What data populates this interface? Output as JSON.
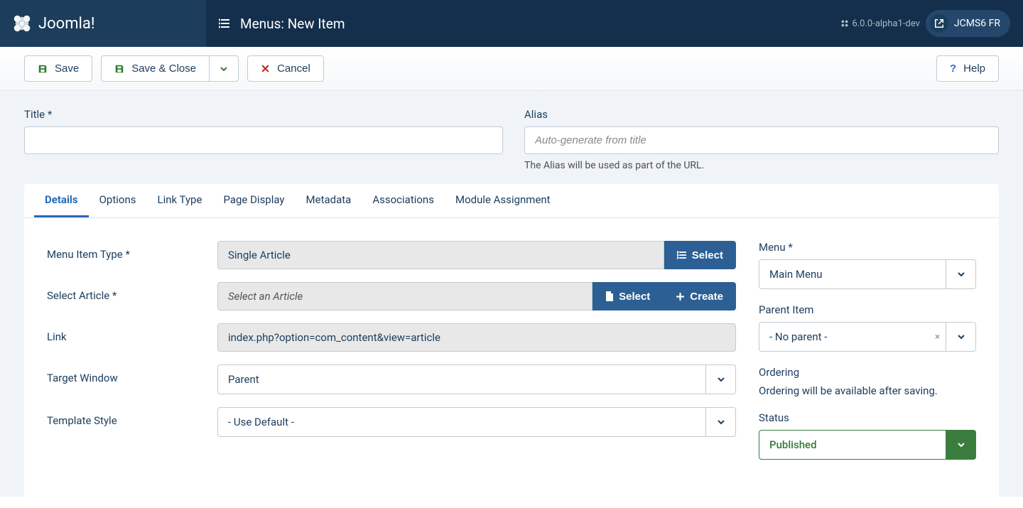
{
  "app": {
    "brand": "Joomla!",
    "version": "6.0.0-alpha1-dev",
    "site_name": "JCMS6 FR"
  },
  "page": {
    "title": "Menus: New Item"
  },
  "toolbar": {
    "save": "Save",
    "save_close": "Save & Close",
    "cancel": "Cancel",
    "help": "Help"
  },
  "fields": {
    "title_label": "Title *",
    "alias_label": "Alias",
    "alias_placeholder": "Auto-generate from title",
    "alias_help": "The Alias will be used as part of the URL."
  },
  "tabs": [
    "Details",
    "Options",
    "Link Type",
    "Page Display",
    "Metadata",
    "Associations",
    "Module Assignment"
  ],
  "details": {
    "menu_item_type_label": "Menu Item Type *",
    "menu_item_type_value": "Single Article",
    "select_btn": "Select",
    "select_article_label": "Select Article *",
    "select_article_placeholder": "Select an Article",
    "article_select_btn": "Select",
    "article_create_btn": "Create",
    "link_label": "Link",
    "link_value": "index.php?option=com_content&view=article",
    "target_window_label": "Target Window",
    "target_window_value": "Parent",
    "template_style_label": "Template Style",
    "template_style_value": "- Use Default -"
  },
  "side": {
    "menu_label": "Menu *",
    "menu_value": "Main Menu",
    "parent_label": "Parent Item",
    "parent_value": "- No parent -",
    "ordering_label": "Ordering",
    "ordering_text": "Ordering will be available after saving.",
    "status_label": "Status",
    "status_value": "Published"
  }
}
